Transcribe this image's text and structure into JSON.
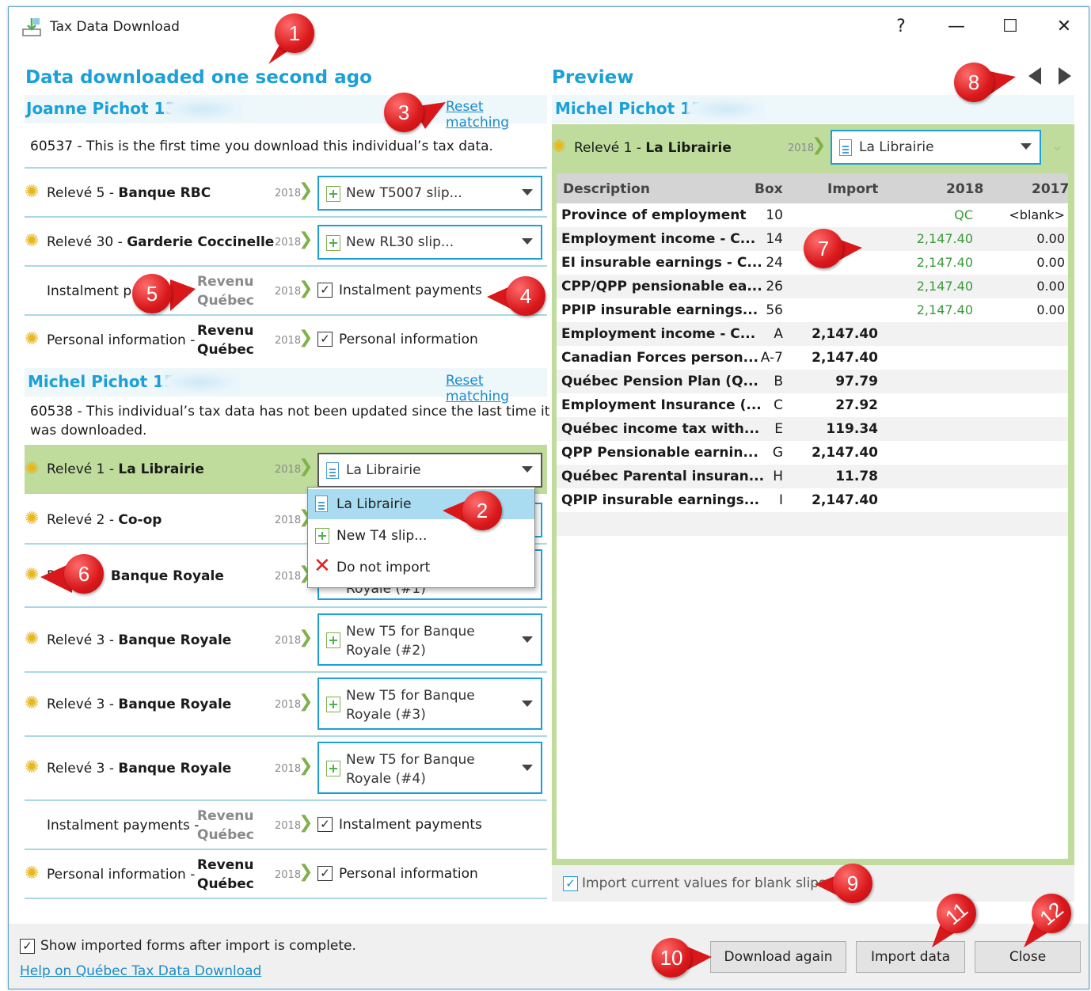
{
  "window": {
    "title": "Tax Data Download",
    "help_glyph": "?",
    "minimize_glyph": "—",
    "maximize_glyph": "☐",
    "close_glyph": "✕"
  },
  "left": {
    "heading": "Data downloaded one second ago",
    "persons": [
      {
        "name": "Joanne Pichot 139",
        "reset_label": "Reset matching",
        "message": "60537 - This is the first time you download this individual’s tax data.",
        "rows": [
          {
            "type": "Relevé 5",
            "issuer": "Banque RBC",
            "year": "2018",
            "target": "New T5007 slip..."
          },
          {
            "type": "Relevé 30",
            "issuer": "Garderie Coccinelle",
            "year": "2018",
            "target": "New RL30 slip..."
          },
          {
            "type": "Instalment p",
            "issuer_line1": "Revenu",
            "issuer_line2": "Québec",
            "year": "2018",
            "target": "Instalment payments"
          },
          {
            "type": "Personal information",
            "issuer_line1": "Revenu",
            "issuer_line2": "Québec",
            "year": "2018",
            "target": "Personal information"
          }
        ]
      },
      {
        "name": "Michel Pichot 159",
        "reset_label": "Reset matching",
        "message_line1": "60538 - This individual’s tax data has not been updated since the last time it",
        "message_line2": "was downloaded.",
        "rows": [
          {
            "type": "Relevé 1",
            "issuer": "La Librairie",
            "year": "2018",
            "target": "La Librairie"
          },
          {
            "type": "Relevé 2",
            "issuer": "Co-op",
            "year": "2018"
          },
          {
            "type": "Re",
            "issuer": "Banque Royale",
            "year": "2018",
            "target_partial": "Royale (#1)"
          },
          {
            "type": "Relevé 3",
            "issuer": "Banque Royale",
            "year": "2018",
            "target_line1": "New T5 for Banque",
            "target_line2": "Royale (#2)"
          },
          {
            "type": "Relevé 3",
            "issuer": "Banque Royale",
            "year": "2018",
            "target_line1": "New T5 for Banque",
            "target_line2": "Royale (#3)"
          },
          {
            "type": "Relevé 3",
            "issuer": "Banque Royale",
            "year": "2018",
            "target_line1": "New T5 for Banque",
            "target_line2": "Royale (#4)"
          },
          {
            "type": "Instalment payments",
            "issuer_line1": "Revenu",
            "issuer_line2": "Québec",
            "year": "2018",
            "target": "Instalment payments"
          },
          {
            "type": "Personal information",
            "issuer_line1": "Revenu",
            "issuer_line2": "Québec",
            "year": "2018",
            "target": "Personal information"
          }
        ]
      }
    ],
    "dropdown_options": [
      "La Librairie",
      "New T4 slip...",
      "Do not import"
    ]
  },
  "preview": {
    "heading": "Preview",
    "person": "Michel Pichot 159",
    "slip_type": "Relevé 1",
    "slip_issuer": "La Librairie",
    "slip_year": "2018",
    "slip_target": "La Librairie",
    "columns": [
      "Description",
      "Box",
      "Import",
      "2018",
      "2017"
    ],
    "rows": [
      {
        "desc": "Province of employment",
        "box": "10",
        "import": "",
        "y2018": "QC",
        "y2017": "<blank>"
      },
      {
        "desc": "Employment income - C...",
        "box": "14",
        "import": "",
        "y2018": "2,147.40",
        "y2017": "0.00"
      },
      {
        "desc": "EI insurable earnings - C...",
        "box": "24",
        "import": "",
        "y2018": "2,147.40",
        "y2017": "0.00"
      },
      {
        "desc": "CPP/QPP pensionable ea...",
        "box": "26",
        "import": "",
        "y2018": "2,147.40",
        "y2017": "0.00"
      },
      {
        "desc": "PPIP insurable earnings...",
        "box": "56",
        "import": "",
        "y2018": "2,147.40",
        "y2017": "0.00"
      },
      {
        "desc": "Employment income - C...",
        "box": "A",
        "import": "2,147.40",
        "y2018": "",
        "y2017": ""
      },
      {
        "desc": "Canadian Forces person...",
        "box": "A-7",
        "import": "2,147.40",
        "y2018": "",
        "y2017": ""
      },
      {
        "desc": "Québec Pension Plan (Q...",
        "box": "B",
        "import": "97.79",
        "y2018": "",
        "y2017": ""
      },
      {
        "desc": "Employment Insurance (...",
        "box": "C",
        "import": "27.92",
        "y2018": "",
        "y2017": ""
      },
      {
        "desc": "Québec income tax with...",
        "box": "E",
        "import": "119.34",
        "y2018": "",
        "y2017": ""
      },
      {
        "desc": "QPP Pensionable earnin...",
        "box": "G",
        "import": "2,147.40",
        "y2018": "",
        "y2017": ""
      },
      {
        "desc": "Québec Parental insuran...",
        "box": "H",
        "import": "11.78",
        "y2018": "",
        "y2017": ""
      },
      {
        "desc": "QPIP insurable earnings...",
        "box": "I",
        "import": "2,147.40",
        "y2018": "",
        "y2017": ""
      }
    ],
    "blank_slips_label": "Import current values for blank slips"
  },
  "footer": {
    "show_imported_label": "Show imported forms after import is complete.",
    "help_link": "Help on Québec Tax Data Download",
    "download_again": "Download again",
    "import_data": "Import data",
    "close": "Close"
  },
  "callouts": [
    "1",
    "2",
    "3",
    "4",
    "5",
    "6",
    "7",
    "8",
    "9",
    "10",
    "11",
    "12"
  ],
  "colors": {
    "accent": "#1ba0d7",
    "highlight": "#bfdc9c",
    "callout": "#d9181b",
    "positive": "#3a9a3a"
  }
}
